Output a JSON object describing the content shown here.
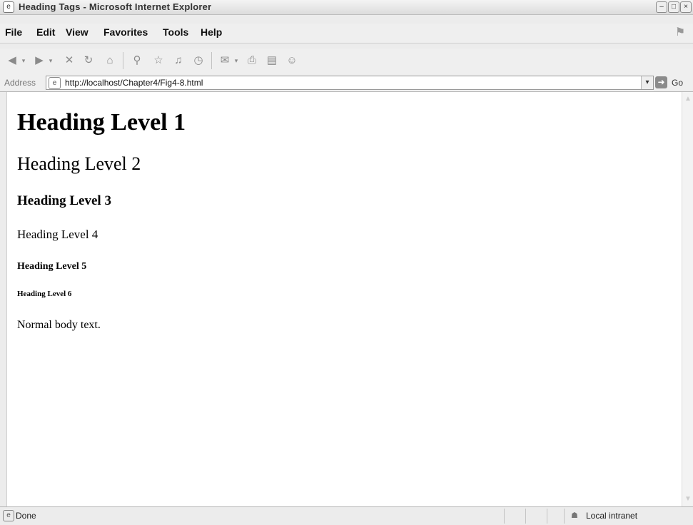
{
  "window": {
    "title": "Heading Tags - Microsoft Internet Explorer",
    "controls": [
      "minimize",
      "maximize",
      "close"
    ]
  },
  "menu": {
    "items": [
      "File",
      "Edit",
      "View",
      "Favorites",
      "Tools",
      "Help"
    ]
  },
  "toolbar": {
    "icons": [
      "back-icon",
      "forward-icon",
      "stop-icon",
      "refresh-icon",
      "home-icon",
      "search-icon",
      "favorites-icon",
      "media-icon",
      "history-icon",
      "mail-icon",
      "print-icon",
      "edit-icon",
      "messenger-icon"
    ]
  },
  "address": {
    "label": "Address",
    "url": "http://localhost/Chapter4/Fig4-8.html",
    "go_label": "Go"
  },
  "content": {
    "h1": "Heading Level 1",
    "h2": "Heading Level 2",
    "h3": "Heading Level 3",
    "h4": "Heading Level 4",
    "h5": "Heading Level 5",
    "h6": "Heading Level 6",
    "body": "Normal body text."
  },
  "status": {
    "text": "Done",
    "zone": "Local intranet"
  }
}
